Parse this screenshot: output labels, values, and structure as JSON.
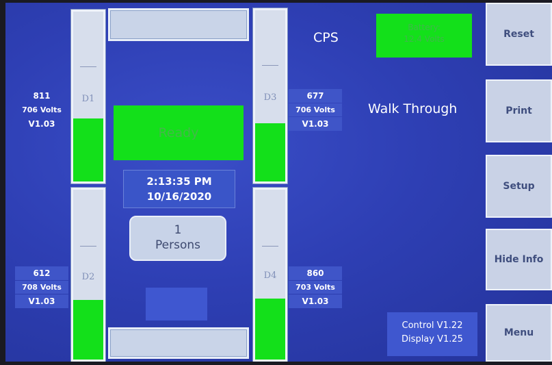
{
  "app": {
    "title": "CPS",
    "mode": "Walk Through",
    "status": "Ready",
    "time": "2:13:35 PM",
    "date": "10/16/2020",
    "persons_count": "1",
    "persons_label": "Persons",
    "battery_label": "Battery:",
    "battery_value": "12.4 Volts",
    "control_version": "Control V1.22",
    "display_version": "Display V1.25"
  },
  "detectors": [
    {
      "label": "D1",
      "count": "811",
      "voltage": "706 Volts",
      "version": "V1.03",
      "level": 0.37
    },
    {
      "label": "D2",
      "count": "612",
      "voltage": "708 Volts",
      "version": "V1.03",
      "level": 0.35
    },
    {
      "label": "D3",
      "count": "677",
      "voltage": "706 Volts",
      "version": "V1.03",
      "level": 0.34
    },
    {
      "label": "D4",
      "count": "860",
      "voltage": "703 Volts",
      "version": "V1.03",
      "level": 0.36
    }
  ],
  "buttons": {
    "reset": "Reset",
    "print": "Print",
    "setup": "Setup",
    "hide_info": "Hide Info",
    "menu": "Menu"
  },
  "colors": {
    "status_green": "#13e01a",
    "screen_blue": "#2e3fb4",
    "button_gray": "#c9d2e6"
  }
}
